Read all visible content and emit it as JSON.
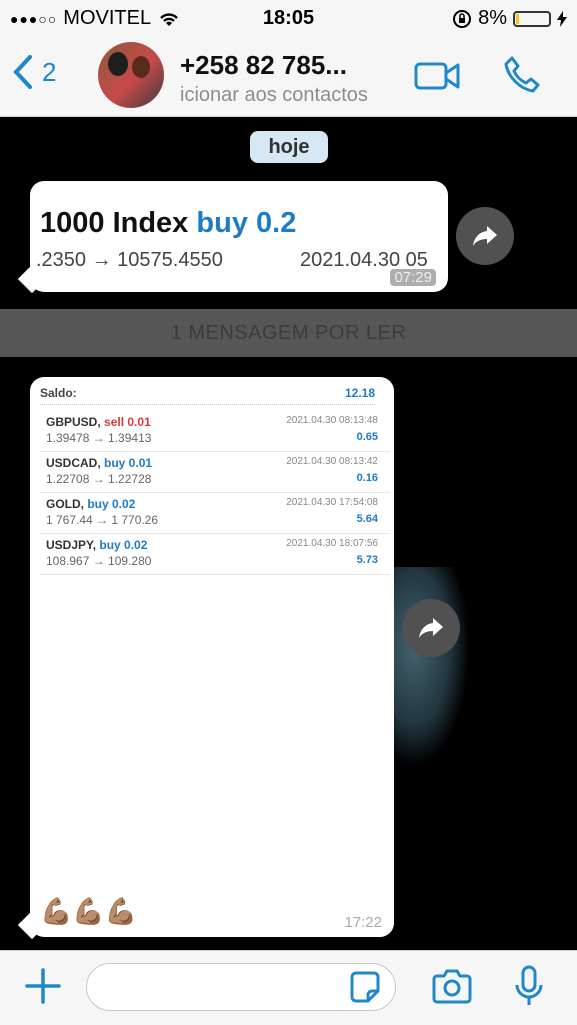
{
  "status": {
    "signal_dots": "●●●○○",
    "carrier": "MOVITEL",
    "time": "18:05",
    "battery": "8%",
    "battery_level": 0.08
  },
  "header": {
    "back_count": "2",
    "contact_name": "+258 82 785...",
    "contact_sub": "icionar aos contactos"
  },
  "chat": {
    "date_pill": "hoje",
    "msg1": {
      "title_main": "1000 Index",
      "title_side": "buy 0.2",
      "prices": ".2350 → 10575.4550",
      "date": "2021.04.30 05",
      "time": "07:29"
    },
    "unread_banner": "1 MENSAGEM POR LER",
    "msg2": {
      "saldo_label": "Saldo:",
      "saldo_value": "12.18",
      "trades": [
        {
          "symbol": "GBPUSD,",
          "side": "sell 0.01",
          "prices": "1.39478 → 1.39413",
          "date": "2021.04.30 08:13:48",
          "pl": "0.65"
        },
        {
          "symbol": "USDCAD,",
          "side": "buy 0.01",
          "prices": "1.22708 → 1.22728",
          "date": "2021.04.30 08:13:42",
          "pl": "0.16"
        },
        {
          "symbol": "GOLD,",
          "side": "buy 0.02",
          "prices": "1 767.44 → 1 770.26",
          "date": "2021.04.30 17:54:08",
          "pl": "5.64"
        },
        {
          "symbol": "USDJPY,",
          "side": "buy 0.02",
          "prices": "108.967 → 109.280",
          "date": "2021.04.30 18:07:56",
          "pl": "5.73"
        }
      ],
      "emoji": "💪🏽💪🏽💪🏽",
      "time": "17:22"
    }
  },
  "input": {
    "placeholder": ""
  },
  "colors": {
    "accent": "#1e88c8",
    "buy": "#1e7bc6",
    "sell": "#d43a3a",
    "unread_bg": "#565656"
  }
}
